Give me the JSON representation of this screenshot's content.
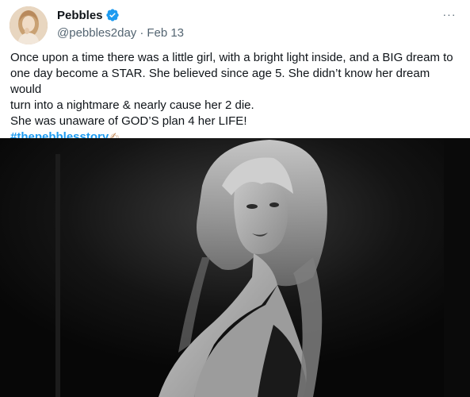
{
  "tweet": {
    "author": {
      "display_name": "Pebbles",
      "handle": "@pebbles2day",
      "verified": true
    },
    "separator": "·",
    "date": "Feb 13",
    "more_icon": "more-horizontal-icon",
    "more_label": "···",
    "text_lines": [
      "Once upon a time there was a little girl, with a bright light inside, and a BIG dream to",
      "one day become a STAR. She believed since age 5. She didn’t know her dream would",
      "turn into a nightmare & nearly cause her 2 die.",
      "She was unaware of GOD’S  plan 4 her LIFE!"
    ],
    "hashtag": "#thepebblesstory",
    "emoji": "✍",
    "media": {
      "type": "image",
      "style": "black-and-white"
    }
  },
  "colors": {
    "accent": "#1d9bf0",
    "text": "#0f1419",
    "secondary_text": "#536471"
  }
}
